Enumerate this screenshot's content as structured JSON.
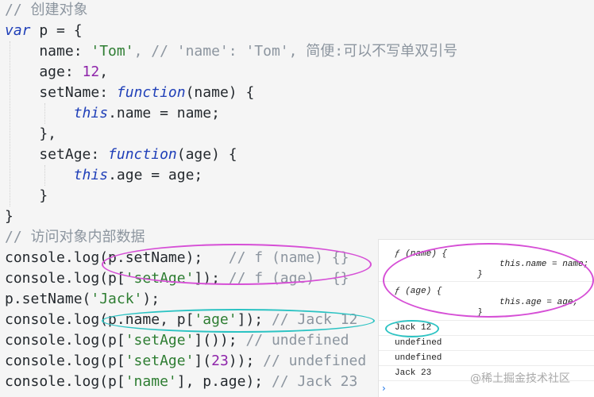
{
  "editor": {
    "l1": {
      "c": "// 创建对象"
    },
    "l2": {
      "kw": "var",
      "id": " p = {"
    },
    "l3": {
      "pre": "    name: ",
      "str": "'Tom'",
      "cm": ", // 'name': 'Tom', 简便:可以不写单双引号"
    },
    "l4": {
      "pre": "    age: ",
      "num": "12",
      "post": ","
    },
    "l5": {
      "pre": "    setName: ",
      "fn": "function",
      "post": "(name) {"
    },
    "l6": {
      "pre": "        ",
      "kw": "this",
      "post": ".name = name;"
    },
    "l7": {
      "t": "    },"
    },
    "l8": {
      "pre": "    setAge: ",
      "fn": "function",
      "post": "(age) {"
    },
    "l9": {
      "pre": "        ",
      "kw": "this",
      "post": ".age = age;"
    },
    "l10": {
      "t": "    }"
    },
    "l11": {
      "t": "}"
    },
    "l12": {
      "c": "// 访问对象内部数据"
    },
    "l13": {
      "pre": "console.log(p.setName);   ",
      "cm": "// f (name) {}"
    },
    "l14": {
      "pre": "console.log(p[",
      "str": "'setAge'",
      "post": "]); ",
      "cm": "// f (age)  {}"
    },
    "l15": {
      "pre": "p.setName(",
      "str": "'Jack'",
      "post": ");"
    },
    "l16": {
      "pre": "console.log(p.name, p[",
      "str": "'age'",
      "post": "]); ",
      "cm": "// Jack 12"
    },
    "l17": {
      "pre": "console.log(p[",
      "str": "'setAge'",
      "post": "]()); ",
      "cm": "// undefined"
    },
    "l18": {
      "pre": "console.log(p[",
      "str": "'setAge'",
      "post": "](",
      "num": "23",
      "post2": ")); ",
      "cm": "// undefined"
    },
    "l19": {
      "pre": "console.log(p[",
      "str": "'name'",
      "post": "], p.age); ",
      "cm": "// Jack 23"
    }
  },
  "console": {
    "r1a": "ƒ (name) {",
    "r1b": "this.name = name;",
    "r1c": "}",
    "r2a": "ƒ (age) {",
    "r2b": "this.age = age;",
    "r2c": "}",
    "r3": "Jack 12",
    "r4": "undefined",
    "r5": "undefined",
    "r6": "Jack 23",
    "prompt": "›"
  },
  "watermark": "@稀土掘金技术社区",
  "colors": {
    "magenta_oval": "#d64fd6",
    "cyan_oval": "#2cc3c3",
    "keyword": "#1f3fb8",
    "string": "#2e7d32",
    "number": "#8e24aa",
    "comment": "#8c959f"
  }
}
